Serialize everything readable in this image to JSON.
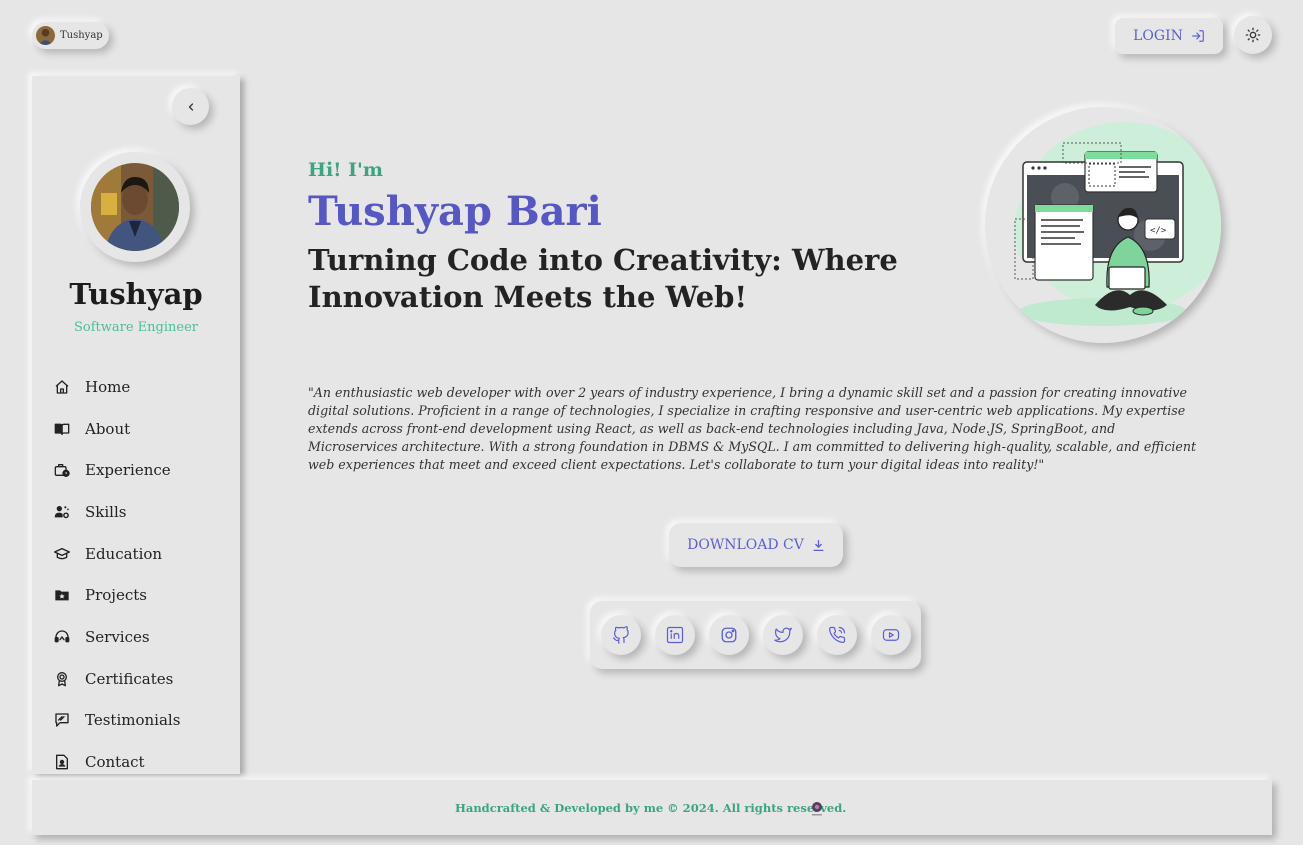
{
  "header": {
    "user_chip_name": "Tushyap",
    "login_label": "LOGIN",
    "accent_color": "#5b5fd6"
  },
  "sidebar": {
    "name": "Tushyap",
    "role": "Software Engineer",
    "items": [
      {
        "label": "Home",
        "icon": "home-icon"
      },
      {
        "label": "About",
        "icon": "book-icon"
      },
      {
        "label": "Experience",
        "icon": "briefcase-clock-icon"
      },
      {
        "label": "Skills",
        "icon": "user-gear-icon"
      },
      {
        "label": "Education",
        "icon": "graduation-cap-icon"
      },
      {
        "label": "Projects",
        "icon": "folder-star-icon"
      },
      {
        "label": "Services",
        "icon": "headset-icon"
      },
      {
        "label": "Certificates",
        "icon": "award-icon"
      },
      {
        "label": "Testimonials",
        "icon": "message-quote-icon"
      },
      {
        "label": "Contact",
        "icon": "contact-file-icon"
      }
    ]
  },
  "hero": {
    "greeting": "Hi! I'm",
    "name": "Tushyap Bari",
    "tagline": "Turning Code into Creativity: Where Innovation Meets the Web!",
    "bio": "\"An enthusiastic web developer with over 2 years of industry experience, I bring a dynamic skill set and a passion for creating innovative digital solutions. Proficient in a range of technologies, I specialize in crafting responsive and user-centric web applications. My expertise extends across front-end development using React, as well as back-end technologies including Java, Node.JS, SpringBoot, and Microservices architecture. With a strong foundation in DBMS & MySQL. I am committed to delivering high-quality, scalable, and efficient web experiences that meet and exceed client expectations. Let's collaborate to turn your digital ideas into reality!\"",
    "download_label": "DOWNLOAD CV"
  },
  "social": [
    {
      "name": "github-icon"
    },
    {
      "name": "linkedin-icon"
    },
    {
      "name": "instagram-icon"
    },
    {
      "name": "twitter-icon"
    },
    {
      "name": "phone-icon"
    },
    {
      "name": "youtube-icon"
    }
  ],
  "footer": {
    "text": "Handcrafted & Developed by me © 2024. All rights reserved."
  },
  "colors": {
    "background": "#e6e6e6",
    "accent_green": "#3aa57f",
    "name_purple": "#5656c4"
  }
}
